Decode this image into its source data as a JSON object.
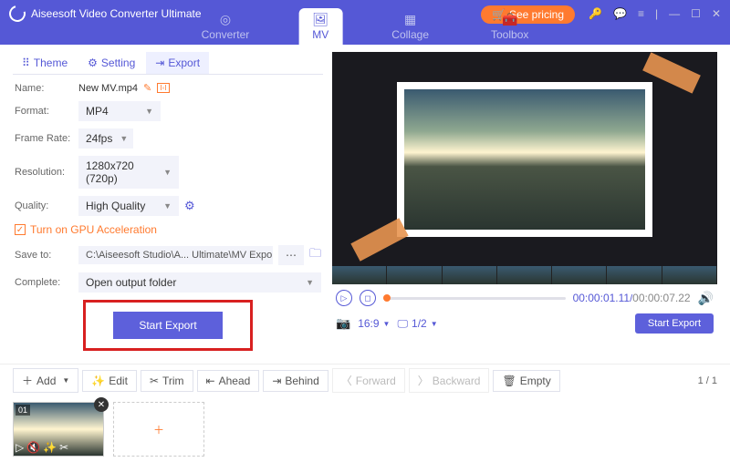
{
  "app": {
    "title": "Aiseesoft Video Converter Ultimate",
    "pricing": "See pricing"
  },
  "nav": {
    "converter": "Converter",
    "mv": "MV",
    "collage": "Collage",
    "toolbox": "Toolbox"
  },
  "subtabs": {
    "theme": "Theme",
    "setting": "Setting",
    "export": "Export"
  },
  "form": {
    "name_lbl": "Name:",
    "name_val": "New MV.mp4",
    "format_lbl": "Format:",
    "format_val": "MP4",
    "framerate_lbl": "Frame Rate:",
    "framerate_val": "24fps",
    "resolution_lbl": "Resolution:",
    "resolution_val": "1280x720 (720p)",
    "quality_lbl": "Quality:",
    "quality_val": "High Quality",
    "gpu": "Turn on GPU Acceleration",
    "saveto_lbl": "Save to:",
    "saveto_val": "C:\\Aiseesoft Studio\\A... Ultimate\\MV Exported",
    "complete_lbl": "Complete:",
    "complete_val": "Open output folder",
    "start": "Start Export"
  },
  "player": {
    "cur": "00:00:01.11",
    "tot": "00:00:07.22",
    "ratio": "16:9",
    "page": "1/2"
  },
  "export2": "Start Export",
  "toolbar": {
    "add": "Add",
    "edit": "Edit",
    "trim": "Trim",
    "ahead": "Ahead",
    "behind": "Behind",
    "forward": "Forward",
    "backward": "Backward",
    "empty": "Empty",
    "pager": "1 / 1"
  },
  "thumb": {
    "num": "01"
  }
}
